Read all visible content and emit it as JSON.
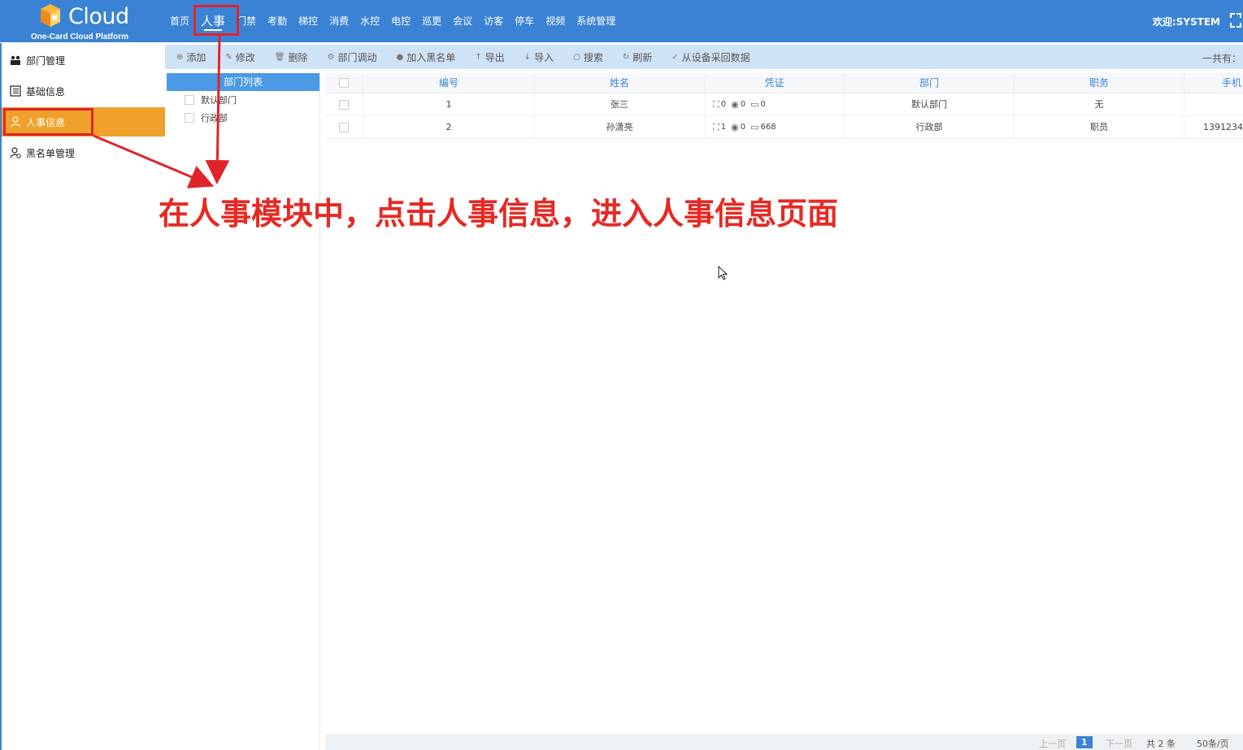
{
  "header": {
    "logo_text": "Cloud",
    "logo_sub": "One-Card Cloud Platform",
    "nav": [
      "首页",
      "人事",
      "门禁",
      "考勤",
      "梯控",
      "消费",
      "水控",
      "电控",
      "巡更",
      "会议",
      "访客",
      "停车",
      "视频",
      "系统管理"
    ],
    "active_nav": "人事",
    "welcome": "欢迎:SYSTEM"
  },
  "sidebar": {
    "items": [
      {
        "label": "部门管理",
        "icon": "group-icon"
      },
      {
        "label": "基础信息",
        "icon": "list-icon"
      },
      {
        "label": "人事信息",
        "icon": "person-icon"
      },
      {
        "label": "黑名单管理",
        "icon": "person-block-icon"
      }
    ],
    "active": "人事信息"
  },
  "toolbar": {
    "buttons": [
      {
        "label": "添加",
        "glyph": "⊕"
      },
      {
        "label": "修改",
        "glyph": "✎"
      },
      {
        "label": "删除",
        "glyph": "🗑"
      },
      {
        "label": "部门调动",
        "glyph": "⚙"
      },
      {
        "label": "加入黑名单",
        "glyph": "●"
      },
      {
        "label": "导出",
        "glyph": "↑"
      },
      {
        "label": "导入",
        "glyph": "↓"
      },
      {
        "label": "搜索",
        "glyph": "○"
      },
      {
        "label": "刷新",
        "glyph": "↻"
      },
      {
        "label": "从设备采回数据",
        "glyph": "✓"
      }
    ],
    "total_label": "一共有："
  },
  "dept_panel": {
    "header": "部门列表",
    "items": [
      "默认部门",
      "行政部"
    ]
  },
  "table": {
    "columns": [
      "编号",
      "姓名",
      "凭证",
      "部门",
      "职务",
      "手机"
    ],
    "rows": [
      {
        "id": "1",
        "name": "张三",
        "face": "0",
        "finger": "0",
        "card": "0",
        "dept": "默认部门",
        "title": "无",
        "phone": ""
      },
      {
        "id": "2",
        "name": "孙潇亮",
        "face": "1",
        "finger": "0",
        "card": "668",
        "dept": "行政部",
        "title": "职员",
        "phone": "1391234"
      }
    ]
  },
  "pagination": {
    "prev": "上一页",
    "current": "1",
    "next": "下一页",
    "total": "共 2 条",
    "per_page": "50条/页"
  },
  "annotation": {
    "text": "在人事模块中，点击人事信息，进入人事信息页面",
    "color": "#e52a24"
  },
  "colors": {
    "header_bg": "#3a83d4",
    "active_side": "#f0a12b",
    "toolbar_bg": "#cfe3f7",
    "highlight": "#e0242b"
  }
}
